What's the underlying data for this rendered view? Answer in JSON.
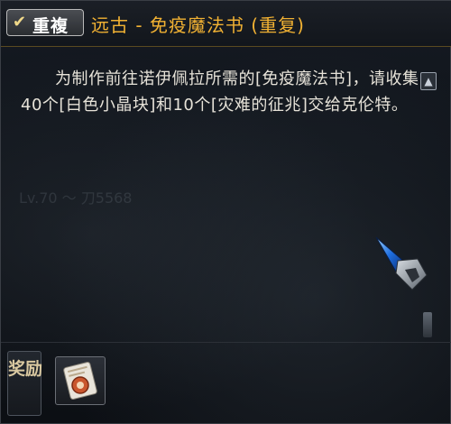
{
  "titlebar": {
    "badge_label": "重複",
    "badge_icon": "check-icon",
    "quest_title": "远古 - 免疫魔法书 (重复)"
  },
  "description": {
    "text": "为制作前往诺伊佩拉所需的[免疫魔法书]，请收集40个[白色小晶块]和10个[灾难的征兆]交给克伦特。"
  },
  "background_ghost_text": "Lv.70 ～ 刀5568",
  "rewards": {
    "label": "奖励",
    "items": [
      {
        "icon": "item-scroll-icon"
      }
    ]
  },
  "colors": {
    "title": "#f2b233",
    "text": "#e6e2d8",
    "accent_border": "#5a4a20"
  }
}
